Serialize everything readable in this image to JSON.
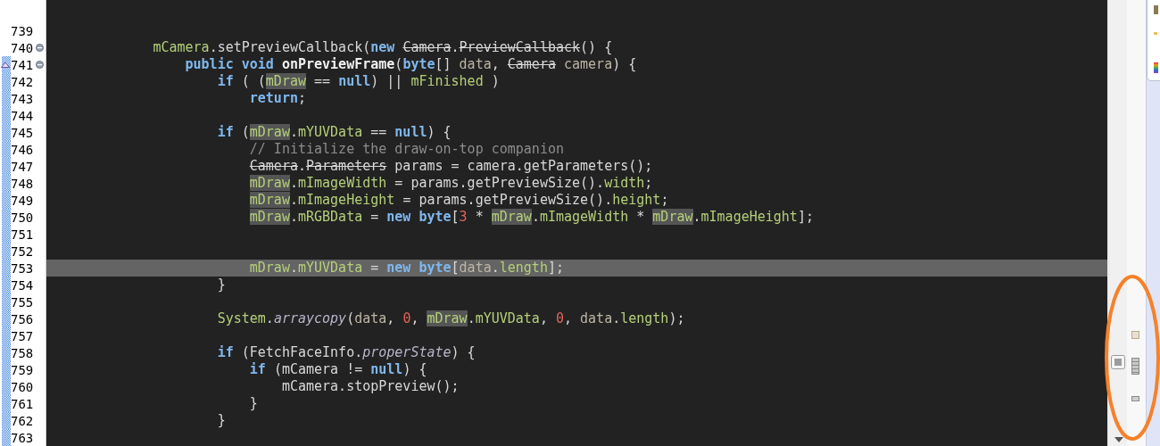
{
  "editor": {
    "lines": [
      {
        "number": "739",
        "changed": false,
        "foldable": false,
        "marker": false,
        "current": false
      },
      {
        "number": "740",
        "changed": false,
        "foldable": true,
        "marker": false,
        "current": false,
        "tokens": [
          {
            "kind": "field",
            "text": "            mCamera"
          },
          {
            "kind": "plain",
            "text": ".setPreviewCallback("
          },
          {
            "kind": "keyword",
            "text": "new"
          },
          {
            "kind": "strike",
            "text": " Camera"
          },
          {
            "kind": "plain",
            "text": "."
          },
          {
            "kind": "strike",
            "text": "PreviewCallback"
          },
          {
            "kind": "plain",
            "text": "() {"
          }
        ]
      },
      {
        "number": "741",
        "changed": true,
        "foldable": true,
        "marker": true,
        "current": false,
        "tokens": [
          {
            "kind": "keyword",
            "text": "                public void"
          },
          {
            "kind": "bold",
            "text": " onPreviewFrame"
          },
          {
            "kind": "plain",
            "text": "("
          },
          {
            "kind": "keyword",
            "text": "byte"
          },
          {
            "kind": "plain",
            "text": "[]"
          },
          {
            "kind": "param",
            "text": " data"
          },
          {
            "kind": "plain",
            "text": ","
          },
          {
            "kind": "strike",
            "text": " Camera"
          },
          {
            "kind": "param",
            "text": " camera"
          },
          {
            "kind": "plain",
            "text": ") {"
          }
        ]
      },
      {
        "number": "742",
        "changed": true,
        "foldable": false,
        "marker": false,
        "current": false,
        "tokens": [
          {
            "kind": "keyword",
            "text": "                    if"
          },
          {
            "kind": "plain",
            "text": " ( ("
          },
          {
            "kind": "mark",
            "text": "mDraw"
          },
          {
            "kind": "plain",
            "text": " =="
          },
          {
            "kind": "keyword",
            "text": " null"
          },
          {
            "kind": "plain",
            "text": ") ||"
          },
          {
            "kind": "field",
            "text": " mFinished"
          },
          {
            "kind": "plain",
            "text": " )"
          }
        ]
      },
      {
        "number": "743",
        "changed": true,
        "foldable": false,
        "marker": false,
        "current": false,
        "tokens": [
          {
            "kind": "keyword",
            "text": "                        return"
          },
          {
            "kind": "plain",
            "text": ";"
          }
        ]
      },
      {
        "number": "744",
        "changed": true,
        "foldable": false,
        "marker": false,
        "current": false
      },
      {
        "number": "745",
        "changed": true,
        "foldable": false,
        "marker": false,
        "current": false,
        "tokens": [
          {
            "kind": "keyword",
            "text": "                    if"
          },
          {
            "kind": "plain",
            "text": " ("
          },
          {
            "kind": "mark",
            "text": "mDraw"
          },
          {
            "kind": "plain",
            "text": "."
          },
          {
            "kind": "field",
            "text": "mYUVData"
          },
          {
            "kind": "plain",
            "text": " =="
          },
          {
            "kind": "keyword",
            "text": " null"
          },
          {
            "kind": "plain",
            "text": ") {"
          }
        ]
      },
      {
        "number": "746",
        "changed": true,
        "foldable": false,
        "marker": false,
        "current": false,
        "tokens": [
          {
            "kind": "comment",
            "text": "                        // Initialize the draw-on-top companion"
          }
        ]
      },
      {
        "number": "747",
        "changed": true,
        "foldable": false,
        "marker": false,
        "current": false,
        "tokens": [
          {
            "kind": "strike",
            "text": "                        Camera"
          },
          {
            "kind": "plain",
            "text": "."
          },
          {
            "kind": "strike",
            "text": "Parameters"
          },
          {
            "kind": "plain",
            "text": " params = camera.getParameters();"
          }
        ]
      },
      {
        "number": "748",
        "changed": true,
        "foldable": false,
        "marker": false,
        "current": false,
        "tokens": [
          {
            "kind": "mark",
            "text": "                        mDraw"
          },
          {
            "kind": "plain",
            "text": "."
          },
          {
            "kind": "field",
            "text": "mImageWidth"
          },
          {
            "kind": "plain",
            "text": " = params.getPreviewSize()."
          },
          {
            "kind": "field",
            "text": "width"
          },
          {
            "kind": "plain",
            "text": ";"
          }
        ]
      },
      {
        "number": "749",
        "changed": true,
        "foldable": false,
        "marker": false,
        "current": false,
        "tokens": [
          {
            "kind": "mark",
            "text": "                        mDraw"
          },
          {
            "kind": "plain",
            "text": "."
          },
          {
            "kind": "field",
            "text": "mImageHeight"
          },
          {
            "kind": "plain",
            "text": " = params.getPreviewSize()."
          },
          {
            "kind": "field",
            "text": "height"
          },
          {
            "kind": "plain",
            "text": ";"
          }
        ]
      },
      {
        "number": "750",
        "changed": true,
        "foldable": false,
        "marker": false,
        "current": false,
        "tokens": [
          {
            "kind": "mark",
            "text": "                        mDraw"
          },
          {
            "kind": "plain",
            "text": "."
          },
          {
            "kind": "field",
            "text": "mRGBData"
          },
          {
            "kind": "plain",
            "text": " ="
          },
          {
            "kind": "keyword",
            "text": " new byte"
          },
          {
            "kind": "plain",
            "text": "["
          },
          {
            "kind": "num",
            "text": "3"
          },
          {
            "kind": "plain",
            "text": " *"
          },
          {
            "kind": "mark",
            "text": " mDraw"
          },
          {
            "kind": "plain",
            "text": "."
          },
          {
            "kind": "field",
            "text": "mImageWidth"
          },
          {
            "kind": "plain",
            "text": " *"
          },
          {
            "kind": "mark",
            "text": " mDraw"
          },
          {
            "kind": "plain",
            "text": "."
          },
          {
            "kind": "field",
            "text": "mImageHeight"
          },
          {
            "kind": "plain",
            "text": "];"
          }
        ]
      },
      {
        "number": "751",
        "changed": true,
        "foldable": false,
        "marker": false,
        "current": false
      },
      {
        "number": "752",
        "changed": true,
        "foldable": false,
        "marker": false,
        "current": false
      },
      {
        "number": "753",
        "changed": true,
        "foldable": false,
        "marker": false,
        "current": true,
        "tokens": [
          {
            "kind": "field",
            "text": "                        mDraw"
          },
          {
            "kind": "plain",
            "text": "."
          },
          {
            "kind": "field",
            "text": "mYUVData"
          },
          {
            "kind": "plain",
            "text": " ="
          },
          {
            "kind": "keyword",
            "text": " new byte"
          },
          {
            "kind": "plain",
            "text": "["
          },
          {
            "kind": "param",
            "text": "data"
          },
          {
            "kind": "plain",
            "text": "."
          },
          {
            "kind": "field",
            "text": "length"
          },
          {
            "kind": "plain",
            "text": "];"
          }
        ]
      },
      {
        "number": "754",
        "changed": true,
        "foldable": false,
        "marker": false,
        "current": false,
        "tokens": [
          {
            "kind": "plain",
            "text": "                    }"
          }
        ]
      },
      {
        "number": "755",
        "changed": true,
        "foldable": false,
        "marker": false,
        "current": false
      },
      {
        "number": "756",
        "changed": true,
        "foldable": false,
        "marker": false,
        "current": false,
        "tokens": [
          {
            "kind": "field",
            "text": "                    System"
          },
          {
            "kind": "plain",
            "text": "."
          },
          {
            "kind": "static",
            "text": "arraycopy"
          },
          {
            "kind": "plain",
            "text": "("
          },
          {
            "kind": "param",
            "text": "data"
          },
          {
            "kind": "plain",
            "text": ","
          },
          {
            "kind": "num",
            "text": " 0"
          },
          {
            "kind": "plain",
            "text": ","
          },
          {
            "kind": "mark",
            "text": " mDraw"
          },
          {
            "kind": "plain",
            "text": "."
          },
          {
            "kind": "field",
            "text": "mYUVData"
          },
          {
            "kind": "plain",
            "text": ","
          },
          {
            "kind": "num",
            "text": " 0"
          },
          {
            "kind": "plain",
            "text": ","
          },
          {
            "kind": "param",
            "text": " data"
          },
          {
            "kind": "plain",
            "text": "."
          },
          {
            "kind": "field",
            "text": "length"
          },
          {
            "kind": "plain",
            "text": ");"
          }
        ]
      },
      {
        "number": "757",
        "changed": true,
        "foldable": false,
        "marker": false,
        "current": false
      },
      {
        "number": "758",
        "changed": true,
        "foldable": false,
        "marker": false,
        "current": false,
        "tokens": [
          {
            "kind": "keyword",
            "text": "                    if"
          },
          {
            "kind": "plain",
            "text": " (FetchFaceInfo."
          },
          {
            "kind": "static",
            "text": "properState"
          },
          {
            "kind": "plain",
            "text": ") {"
          }
        ]
      },
      {
        "number": "759",
        "changed": true,
        "foldable": false,
        "marker": false,
        "current": false,
        "tokens": [
          {
            "kind": "keyword",
            "text": "                        if"
          },
          {
            "kind": "plain",
            "text": " (mCamera !="
          },
          {
            "kind": "keyword",
            "text": " null"
          },
          {
            "kind": "plain",
            "text": ") {"
          }
        ]
      },
      {
        "number": "760",
        "changed": true,
        "foldable": false,
        "marker": false,
        "current": false,
        "tokens": [
          {
            "kind": "plain",
            "text": "                            mCamera.stopPreview();"
          }
        ]
      },
      {
        "number": "761",
        "changed": true,
        "foldable": false,
        "marker": false,
        "current": false,
        "tokens": [
          {
            "kind": "plain",
            "text": "                        }"
          }
        ]
      },
      {
        "number": "762",
        "changed": true,
        "foldable": false,
        "marker": false,
        "current": false,
        "tokens": [
          {
            "kind": "plain",
            "text": "                    }"
          }
        ]
      },
      {
        "number": "763",
        "changed": true,
        "foldable": false,
        "marker": false,
        "current": false
      }
    ]
  }
}
